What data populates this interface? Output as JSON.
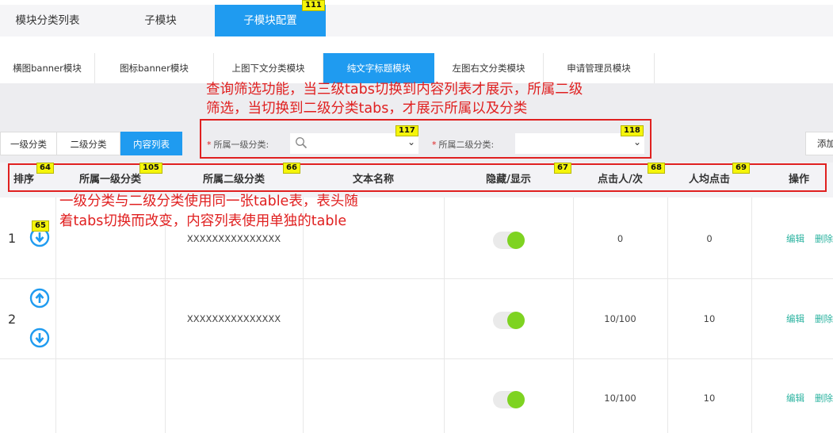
{
  "top_tabs": [
    {
      "label": "模块分类列表"
    },
    {
      "label": "子模块"
    },
    {
      "label": "子模块配置",
      "active": true
    }
  ],
  "sub_tabs": [
    {
      "label": "横图banner模块"
    },
    {
      "label": "图标banner模块"
    },
    {
      "label": "上图下文分类模块"
    },
    {
      "label": "纯文字标题模块",
      "active": true
    },
    {
      "label": "左图右文分类模块"
    },
    {
      "label": "申请管理员模块"
    }
  ],
  "level_tabs": [
    {
      "label": "一级分类"
    },
    {
      "label": "二级分类"
    },
    {
      "label": "内容列表",
      "active": true
    }
  ],
  "add_button": "添加",
  "filters": {
    "required_mark": "*",
    "level1_label": "所属一级分类:",
    "level2_label": "所属二级分类:"
  },
  "annotations": {
    "filter_note_line1": "查询筛选功能，当三级tabs切换到内容列表才展示，所属二级",
    "filter_note_line2": "筛选，当切换到二级分类tabs，才展示所属以及分类",
    "table_note_line1": "一级分类与二级分类使用同一张table表，表头随",
    "table_note_line2": "着tabs切换而改变，内容列表使用单独的table"
  },
  "badges": {
    "tab_config": "111",
    "select1": "117",
    "select2": "118",
    "col_sort": "64",
    "col_level1": "105",
    "col_level2": "66",
    "col_visible": "67",
    "col_clicks": "68",
    "col_avg": "69",
    "row1_down": "65"
  },
  "table": {
    "columns": [
      "排序",
      "所属一级分类",
      "所属二级分类",
      "文本名称",
      "隐藏/显示",
      "点击人/次",
      "人均点击",
      "操作"
    ],
    "rows": [
      {
        "index": "1",
        "level1": "",
        "level2": "XXXXXXXXXXXXXXX",
        "name": "",
        "visible": true,
        "clicks": "0",
        "avg": "0",
        "edit": "编辑",
        "delete": "删除"
      },
      {
        "index": "2",
        "level1": "",
        "level2": "XXXXXXXXXXXXXXX",
        "name": "",
        "visible": true,
        "clicks": "10/100",
        "avg": "10",
        "edit": "编辑",
        "delete": "删除"
      },
      {
        "index": "",
        "level1": "",
        "level2": "",
        "name": "",
        "visible": true,
        "clicks": "10/100",
        "avg": "10",
        "edit": "编辑",
        "delete": "删除"
      }
    ]
  },
  "colors": {
    "accent": "#1f9bf0",
    "annotation": "#e02020",
    "toggle_on": "#7ed321",
    "link": "#2bb3a0",
    "badge": "#f5f50a"
  }
}
